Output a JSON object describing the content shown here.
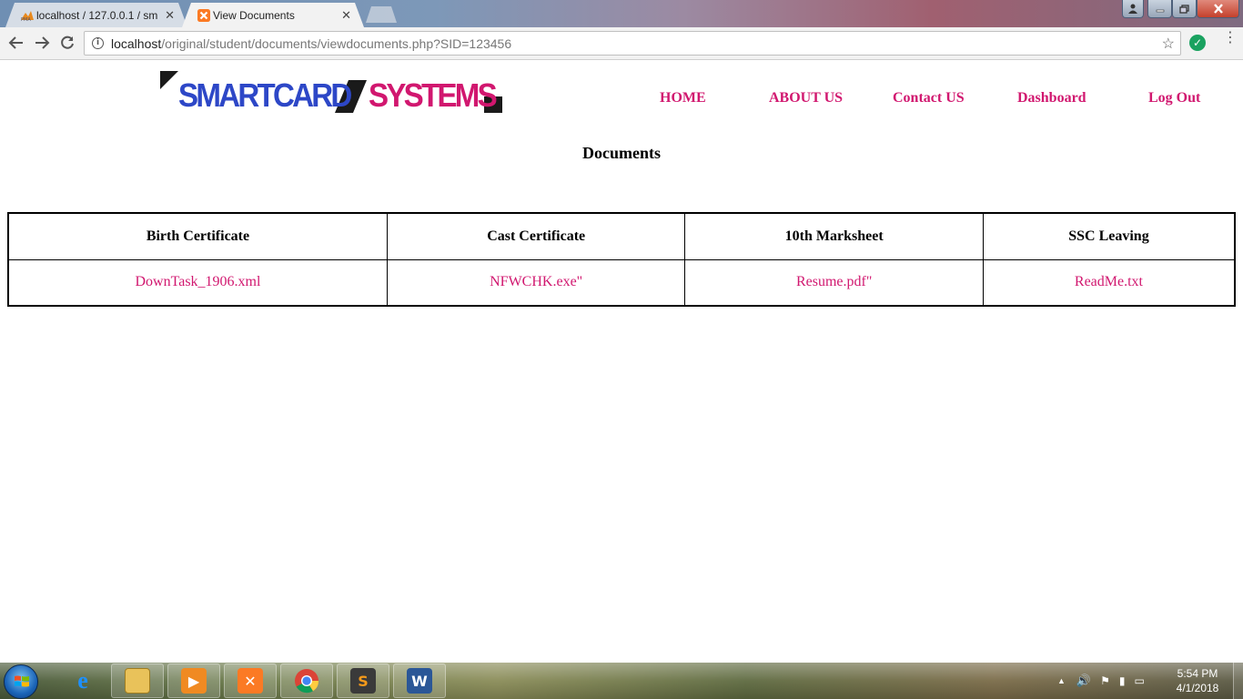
{
  "browser": {
    "tabs": [
      {
        "title": "localhost / 127.0.0.1 / sm",
        "active": false
      },
      {
        "title": "View Documents",
        "active": true
      }
    ],
    "url_host": "localhost",
    "url_path": "/original/student/documents/viewdocuments.php?SID=123456"
  },
  "site": {
    "logo_part1": "SMARTCARD",
    "logo_part2": "SYSTEMS",
    "nav": [
      "HOME",
      "ABOUT US",
      "Contact US",
      "Dashboard",
      "Log Out"
    ]
  },
  "main": {
    "title": "Documents",
    "table": {
      "headers": [
        "Birth Certificate",
        "Cast Certificate",
        "10th Marksheet",
        "SSC Leaving"
      ],
      "rows": [
        [
          "DownTask_1906.xml",
          "NFWCHK.exe\"",
          "Resume.pdf\"",
          "ReadMe.txt"
        ]
      ]
    }
  },
  "taskbar": {
    "time": "5:54 PM",
    "date": "4/1/2018",
    "pinned": [
      "internet-explorer",
      "file-explorer",
      "media-player",
      "xampp",
      "chrome",
      "sublime-text",
      "word"
    ]
  },
  "colors": {
    "accent_pink": "#d1176f",
    "logo_blue": "#2d47c7"
  }
}
